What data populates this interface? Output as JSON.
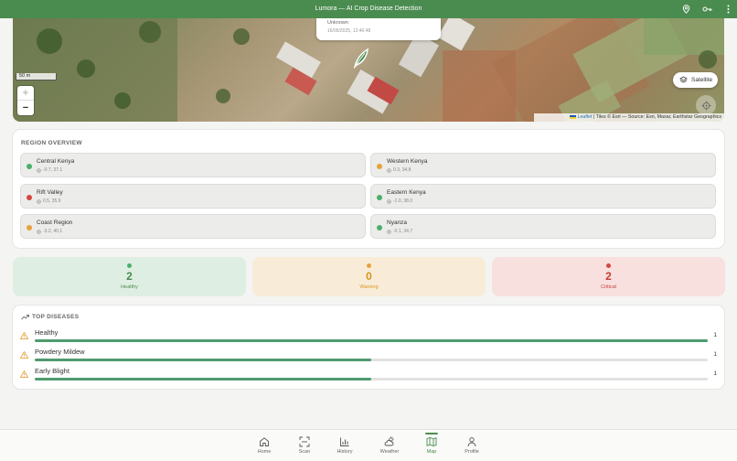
{
  "app": {
    "title": "Lumora — AI Crop Disease Detection",
    "colors": {
      "primary": "#4a8c4f",
      "healthy": "#4caf6a",
      "warning": "#e6a23c",
      "critical": "#d64541"
    },
    "header_icons": [
      "location-pin-icon",
      "key-icon",
      "more-vert-icon"
    ]
  },
  "map": {
    "popup": {
      "line1": "Unknown",
      "line2": "16/05/2025, 12:46:48"
    },
    "scale_label": "50 m",
    "zoom_in": "+",
    "zoom_out": "−",
    "layer_button": "Satellite",
    "attribution_link": "Leaflet",
    "attribution_text": " | Tiles © Esri — Source: Esri, Maxar, Earthstar Geographics"
  },
  "region_overview": {
    "title": "REGION OVERVIEW",
    "regions": [
      {
        "name": "Central Kenya",
        "coords": "-0.7, 37.1",
        "status": "healthy"
      },
      {
        "name": "Western Kenya",
        "coords": "0.3, 34.8",
        "status": "warning"
      },
      {
        "name": "Rift Valley",
        "coords": "0.5, 35.9",
        "status": "critical"
      },
      {
        "name": "Eastern Kenya",
        "coords": "-1.0, 38.0",
        "status": "healthy"
      },
      {
        "name": "Coast Region",
        "coords": "-3.2, 40.1",
        "status": "warning"
      },
      {
        "name": "Nyanza",
        "coords": "-0.1, 34.7",
        "status": "healthy"
      }
    ]
  },
  "stats": [
    {
      "value": "2",
      "label": "Healthy"
    },
    {
      "value": "0",
      "label": "Warning"
    },
    {
      "value": "2",
      "label": "Critical"
    }
  ],
  "top_diseases": {
    "title": "TOP DISEASES",
    "items": [
      {
        "name": "Healthy",
        "count": "1",
        "fraction": 1.0
      },
      {
        "name": "Powdery Mildew",
        "count": "1",
        "fraction": 0.5
      },
      {
        "name": "Early Blight",
        "count": "1",
        "fraction": 0.5
      }
    ]
  },
  "nav": {
    "items": [
      {
        "label": "Home",
        "icon": "home-icon"
      },
      {
        "label": "Scan",
        "icon": "scan-icon"
      },
      {
        "label": "History",
        "icon": "history-chart-icon"
      },
      {
        "label": "Weather",
        "icon": "weather-icon"
      },
      {
        "label": "Map",
        "icon": "map-icon",
        "active": true
      },
      {
        "label": "Profile",
        "icon": "profile-icon"
      }
    ]
  }
}
